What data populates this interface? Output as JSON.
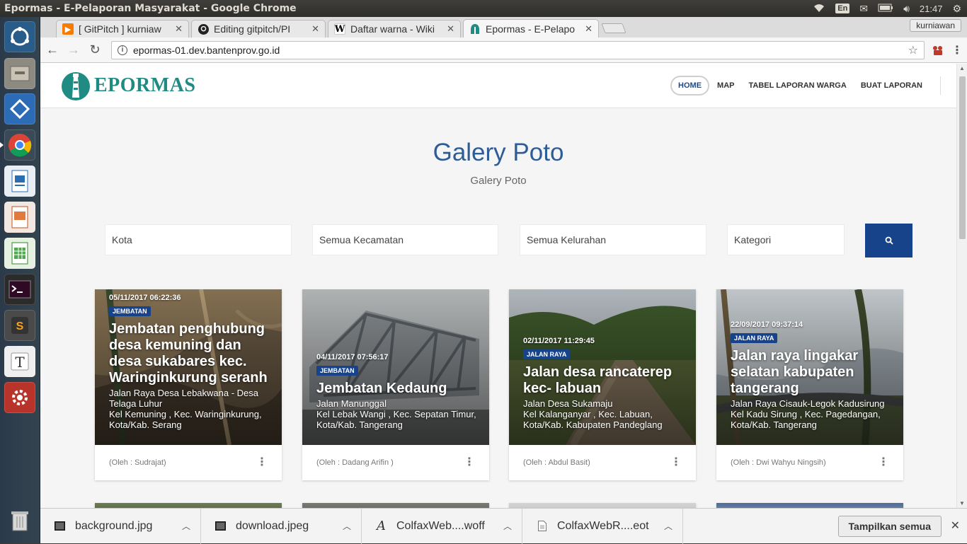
{
  "os": {
    "window_title": "Epormas - E-Pelaporan Masyarakat - Google Chrome",
    "keyboard": "En",
    "clock": "21:47"
  },
  "launcher": {
    "apps": [
      "ubuntu-dash-icon",
      "files-icon",
      "git-icon",
      "chrome-icon",
      "writer-icon",
      "impress-icon",
      "calc-icon",
      "terminal-icon",
      "sublime-icon",
      "text-editor-icon",
      "settings-icon",
      "trash-icon"
    ]
  },
  "browser": {
    "tabs": [
      {
        "label": "[ GitPitch ] kurniaw",
        "favicon": "gitpitch-icon"
      },
      {
        "label": "Editing gitpitch/PI",
        "favicon": "github-icon"
      },
      {
        "label": "Daftar warna - Wiki",
        "favicon": "wikipedia-icon"
      },
      {
        "label": "Epormas - E-Pelapo",
        "favicon": "epormas-icon"
      }
    ],
    "profile": "kurniawan",
    "url": "epormas-01.dev.bantenprov.go.id"
  },
  "site": {
    "logo_text": "EPORMAS",
    "nav": [
      "HOME",
      "MAP",
      "TABEL LAPORAN WARGA",
      "BUAT LAPORAN"
    ],
    "title": "Galery Poto",
    "subtitle": "Galery Poto",
    "filters": [
      "Kota",
      "Semua Kecamatan",
      "Semua Kelurahan",
      "Kategori"
    ],
    "accent": "#17438a",
    "cards": [
      {
        "date": "05/11/2017 06:22:36",
        "category": "JEMBATAN",
        "title": "Jembatan penghubung desa kemuning dan desa sukabares kec. Waringinkurung seranh",
        "address1": "Jalan Raya Desa Lebakwana - Desa Telaga Luhur",
        "address2": "Kel Kemuning , Kec. Waringinkurung, Kota/Kab. Serang",
        "author": "(Oleh : Sudrajat)"
      },
      {
        "date": "04/11/2017 07:56:17",
        "category": "JEMBATAN",
        "title": "Jembatan Kedaung",
        "address1": "Jalan Manunggal",
        "address2": "Kel Lebak Wangi , Kec. Sepatan Timur, Kota/Kab. Tangerang",
        "author": "(Oleh : Dadang Arifin )"
      },
      {
        "date": "02/11/2017 11:29:45",
        "category": "JALAN RAYA",
        "title": "Jalan desa rancaterep kec- labuan",
        "address1": "Jalan Desa Sukamaju",
        "address2": "Kel Kalanganyar , Kec. Labuan, Kota/Kab. Kabupaten Pandeglang",
        "author": "(Oleh : Abdul Basit)"
      },
      {
        "date": "22/09/2017 09:37:14",
        "category": "JALAN RAYA",
        "title": "Jalan raya lingakar selatan kabupaten tangerang",
        "address1": "Jalan Raya Cisauk-Legok Kadusirung",
        "address2": "Kel Kadu Sirung , Kec. Pagedangan, Kota/Kab. Tangerang",
        "author": "(Oleh : Dwi Wahyu Ningsih)"
      }
    ]
  },
  "downloads": {
    "items": [
      {
        "name": "background.jpg",
        "icon": "image-file-icon"
      },
      {
        "name": "download.jpeg",
        "icon": "image-file-icon"
      },
      {
        "name": "ColfaxWeb....woff",
        "icon": "font-file-icon"
      },
      {
        "name": "ColfaxWebR....eot",
        "icon": "file-icon"
      }
    ],
    "show_all": "Tampilkan semua"
  }
}
